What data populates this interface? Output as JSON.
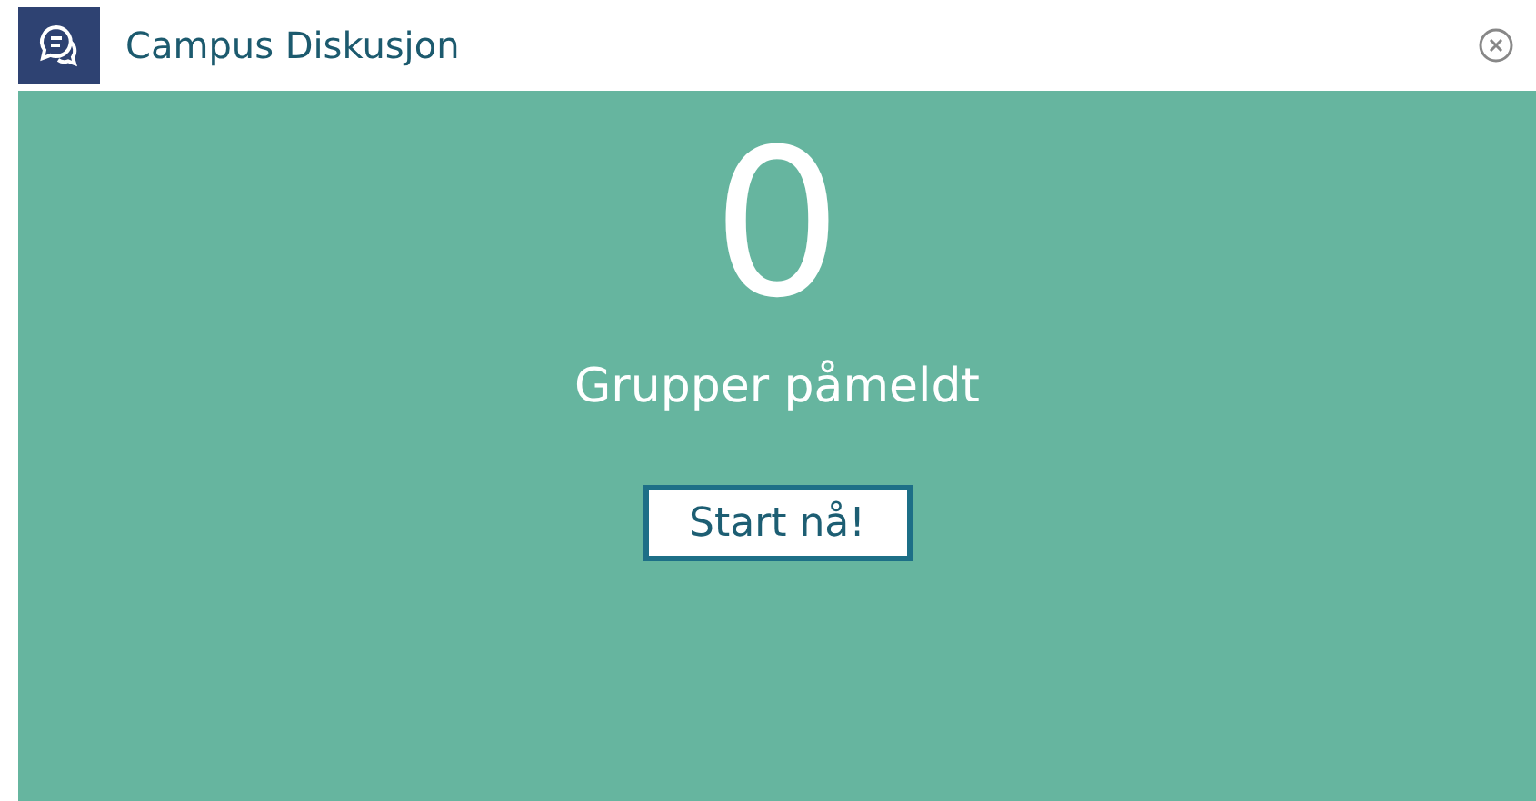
{
  "window": {
    "title": "Campus Diskusjon"
  },
  "counter": {
    "value": "0",
    "label": "Grupper påmeldt"
  },
  "start_button": {
    "label": "Start nå!"
  }
}
